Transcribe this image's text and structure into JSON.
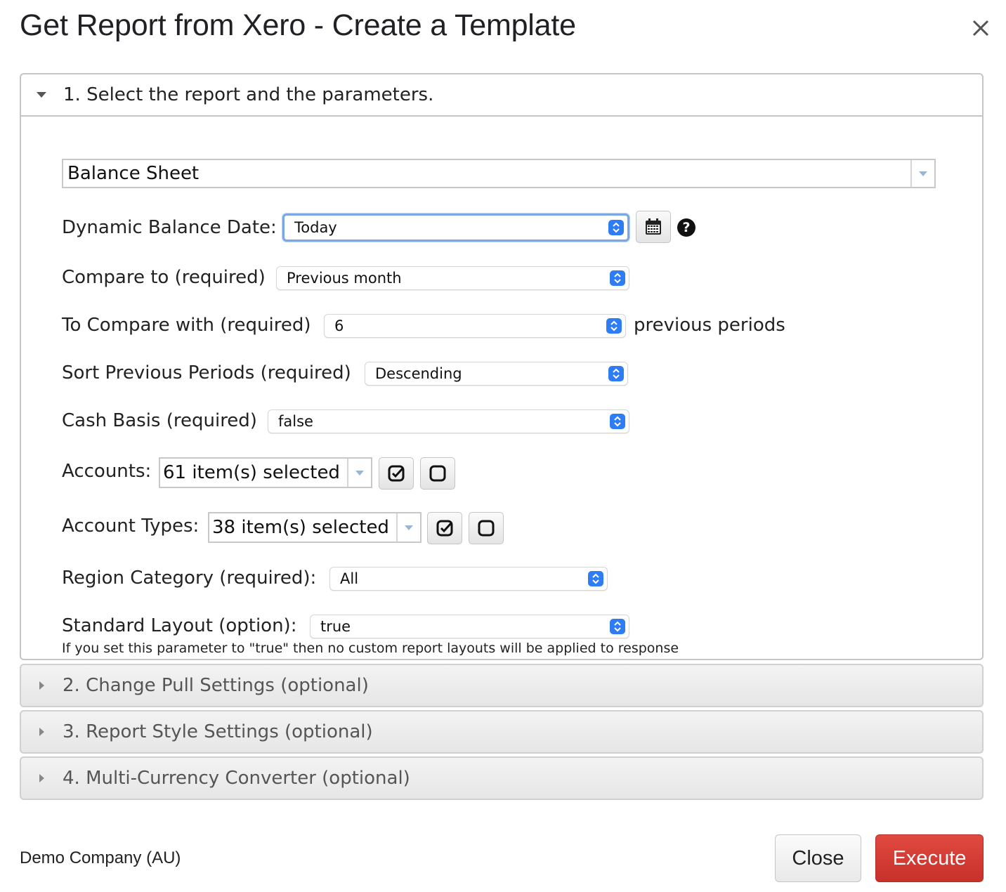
{
  "dialog": {
    "title": "Get Report from Xero - Create a Template"
  },
  "sections": {
    "s1": "1. Select the report and the parameters.",
    "s2": "2. Change Pull Settings (optional)",
    "s3": "3. Report Style Settings (optional)",
    "s4": "4. Multi-Currency Converter (optional)"
  },
  "report": {
    "selected": "Balance Sheet"
  },
  "params": {
    "balance_date": {
      "label": "Dynamic Balance Date:",
      "value": "Today"
    },
    "compare_to": {
      "label": "Compare to (required)",
      "value": "Previous month"
    },
    "compare_with": {
      "label": "To Compare with (required)",
      "value": "6",
      "suffix": "previous periods"
    },
    "sort_periods": {
      "label": "Sort Previous Periods (required)",
      "value": "Descending"
    },
    "cash_basis": {
      "label": "Cash Basis (required)",
      "value": "false"
    },
    "accounts": {
      "label": "Accounts:",
      "value": "61 item(s) selected"
    },
    "account_types": {
      "label": "Account Types:",
      "value": "38 item(s) selected"
    },
    "region": {
      "label": "Region Category (required):",
      "value": "All"
    },
    "standard_layout": {
      "label": "Standard Layout (option):",
      "value": "true",
      "note": "If you set this parameter to \"true\" then no custom report layouts will be applied to response"
    }
  },
  "icons": {
    "calendar": "calendar-icon",
    "help": "?",
    "check_all": "check-square-icon",
    "uncheck_all": "empty-square-icon"
  },
  "footer": {
    "company": "Demo Company (AU)",
    "close_label": "Close",
    "execute_label": "Execute"
  },
  "colors": {
    "accent_blue": "#2f7df4",
    "execute_red": "#d23c34"
  }
}
